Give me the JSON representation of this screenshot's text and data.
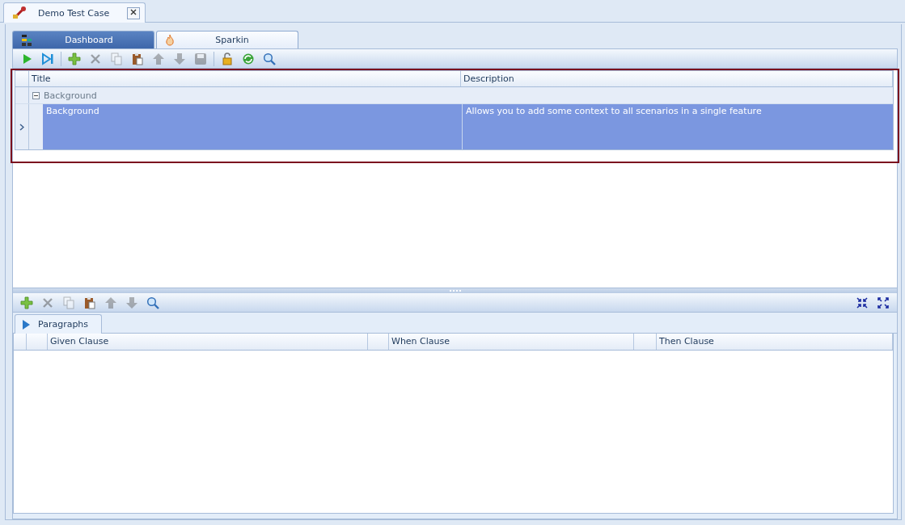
{
  "document_tab": {
    "title": "Demo Test Case"
  },
  "tabs": [
    {
      "label": "Dashboard",
      "selected": false,
      "kind": "dashboard"
    },
    {
      "label": "Sparkin",
      "selected": true,
      "kind": "flame"
    }
  ],
  "top_toolbar": [
    {
      "kind": "play",
      "disabled": false
    },
    {
      "kind": "step",
      "disabled": false
    },
    {
      "kind": "separator"
    },
    {
      "kind": "add",
      "disabled": false
    },
    {
      "kind": "delete",
      "disabled": true
    },
    {
      "kind": "copy",
      "disabled": true
    },
    {
      "kind": "paste",
      "disabled": false
    },
    {
      "kind": "up",
      "disabled": true
    },
    {
      "kind": "down",
      "disabled": true
    },
    {
      "kind": "save",
      "disabled": true
    },
    {
      "kind": "separator"
    },
    {
      "kind": "lock",
      "disabled": false
    },
    {
      "kind": "refresh",
      "disabled": false
    },
    {
      "kind": "search",
      "disabled": false
    }
  ],
  "grid": {
    "columns": [
      "Title",
      "Description"
    ],
    "groups": [
      {
        "label": "Background",
        "expanded": true,
        "rows": [
          {
            "title": "Background",
            "description": "Allows you to add some context to all scenarios in a single feature",
            "selected": true
          }
        ]
      }
    ]
  },
  "bottom_toolbar": [
    {
      "kind": "add",
      "disabled": false
    },
    {
      "kind": "delete",
      "disabled": true
    },
    {
      "kind": "copy",
      "disabled": true
    },
    {
      "kind": "paste",
      "disabled": false
    },
    {
      "kind": "up",
      "disabled": true
    },
    {
      "kind": "down",
      "disabled": true
    },
    {
      "kind": "search",
      "disabled": false
    }
  ],
  "bottom_toolbar_right": [
    {
      "kind": "collapse",
      "disabled": false
    },
    {
      "kind": "expand",
      "disabled": false
    }
  ],
  "detail_tab": {
    "label": "Paragraphs"
  },
  "detail_grid": {
    "columns": [
      "Given Clause",
      "When Clause",
      "Then Clause"
    ]
  }
}
